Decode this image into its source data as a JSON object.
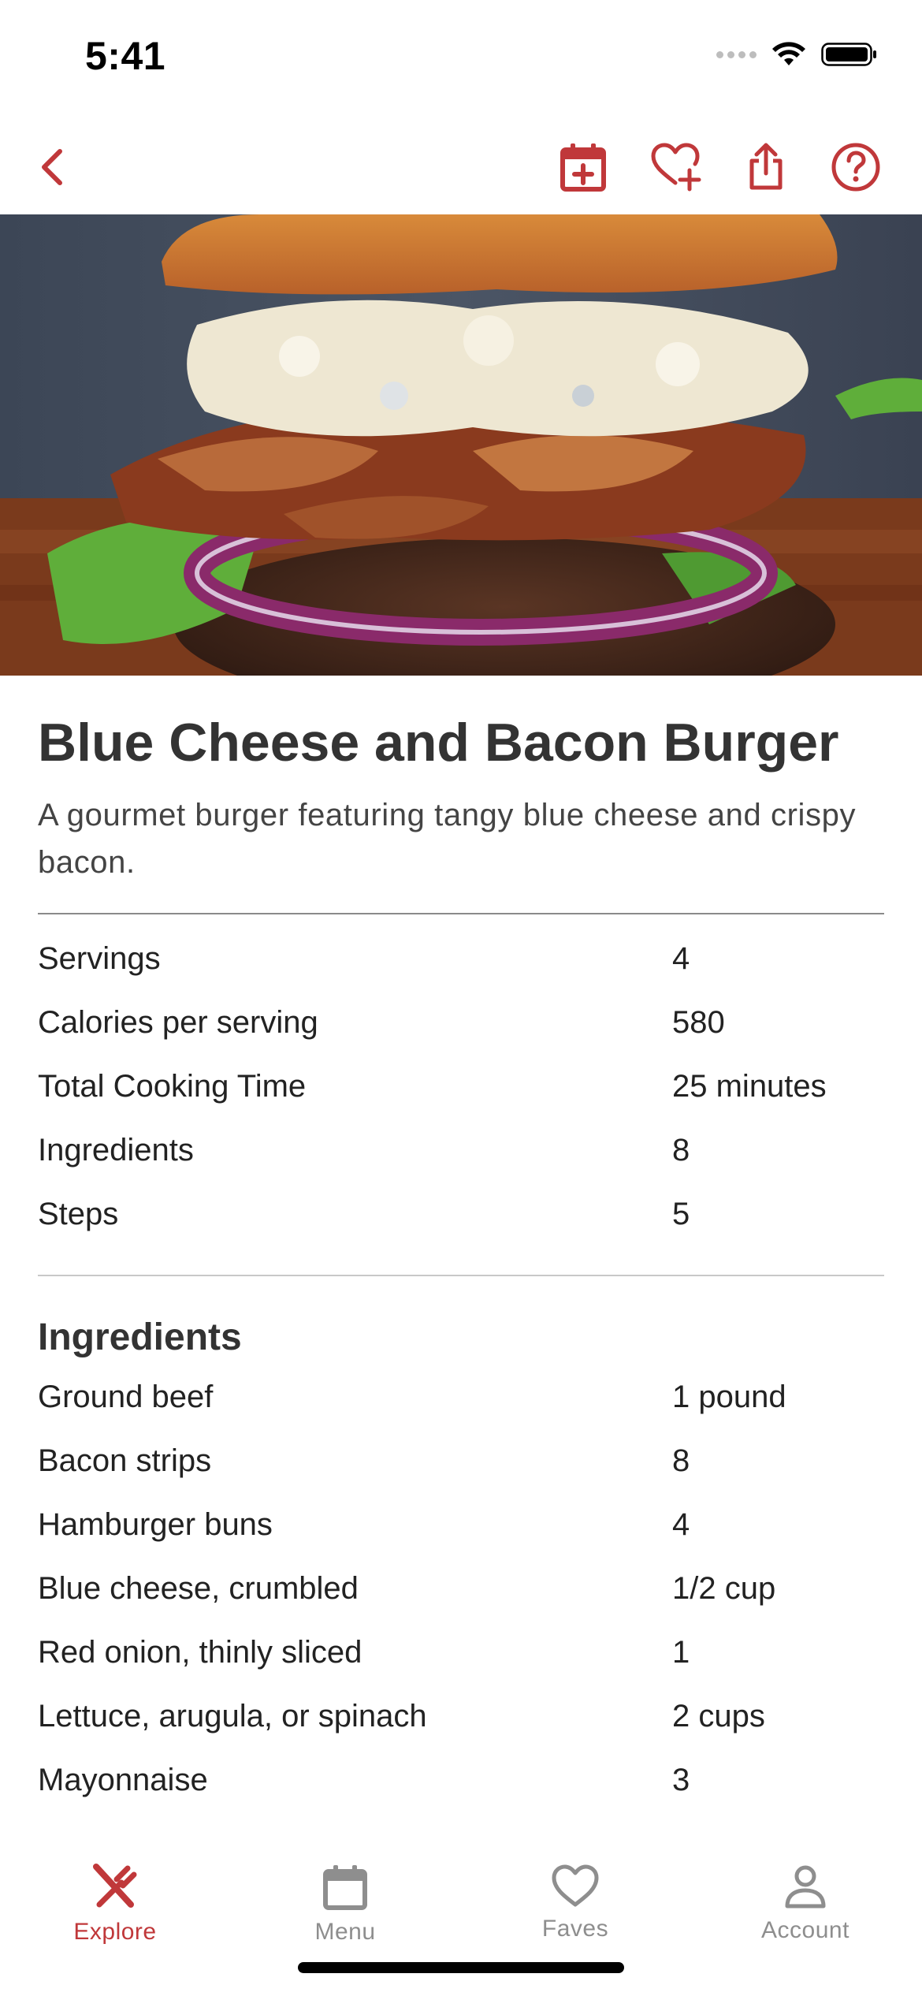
{
  "status": {
    "time": "5:41"
  },
  "colors": {
    "accent": "#c0383a",
    "tab_inactive": "#8e8e8e",
    "text": "#333333"
  },
  "nav": {
    "icons": [
      "back-chevron-icon",
      "calendar-add-icon",
      "heart-add-icon",
      "share-icon",
      "help-icon"
    ]
  },
  "hero": {
    "image": "burger-photo"
  },
  "recipe": {
    "title": "Blue Cheese and Bacon Burger",
    "description": "A gourmet burger featuring tangy blue cheese and crispy bacon."
  },
  "stats": [
    {
      "label": "Servings",
      "value": "4"
    },
    {
      "label": "Calories per serving",
      "value": "580"
    },
    {
      "label": "Total Cooking Time",
      "value": "25 minutes"
    },
    {
      "label": "Ingredients",
      "value": "8"
    },
    {
      "label": "Steps",
      "value": "5"
    }
  ],
  "ingredients": {
    "title": "Ingredients",
    "items": [
      {
        "name": "Ground beef",
        "amount": "1 pound"
      },
      {
        "name": "Bacon strips",
        "amount": "8"
      },
      {
        "name": "Hamburger buns",
        "amount": "4"
      },
      {
        "name": "Blue cheese, crumbled",
        "amount": "1/2 cup"
      },
      {
        "name": "Red onion, thinly sliced",
        "amount": "1"
      },
      {
        "name": "Lettuce, arugula, or spinach",
        "amount": "2 cups"
      },
      {
        "name": "Mayonnaise",
        "amount": "3"
      }
    ]
  },
  "tabs": [
    {
      "label": "Explore",
      "icon": "fork-knife-icon",
      "active": true
    },
    {
      "label": "Menu",
      "icon": "calendar-icon",
      "active": false
    },
    {
      "label": "Faves",
      "icon": "heart-icon",
      "active": false
    },
    {
      "label": "Account",
      "icon": "person-icon",
      "active": false
    }
  ]
}
